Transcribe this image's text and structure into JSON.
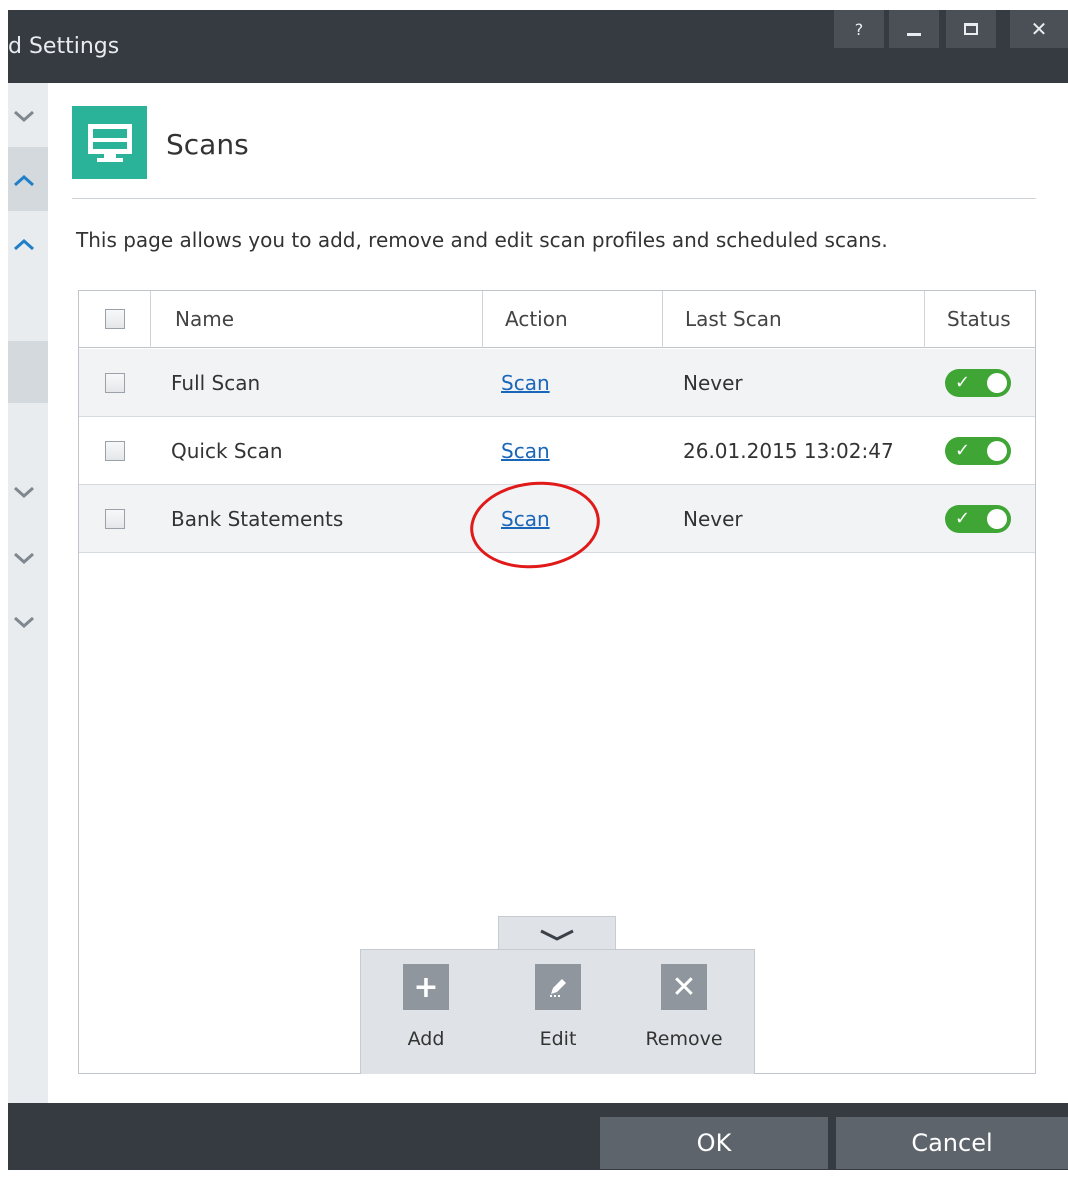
{
  "window": {
    "title": "d Settings",
    "controls": {
      "help": "?"
    }
  },
  "page": {
    "title": "Scans",
    "description": "This page allows you to add, remove and edit scan profiles and scheduled scans."
  },
  "table": {
    "columns": [
      "Name",
      "Action",
      "Last Scan",
      "Status"
    ],
    "rows": [
      {
        "name": "Full Scan",
        "action": "Scan",
        "last_scan": "Never",
        "status_on": true
      },
      {
        "name": "Quick Scan",
        "action": "Scan",
        "last_scan": "26.01.2015 13:02:47",
        "status_on": true
      },
      {
        "name": "Bank Statements",
        "action": "Scan",
        "last_scan": "Never",
        "status_on": true
      }
    ]
  },
  "actions": {
    "add": "Add",
    "edit": "Edit",
    "remove": "Remove"
  },
  "footer": {
    "ok": "OK",
    "cancel": "Cancel"
  },
  "colors": {
    "accent": "#2bb39a",
    "titlebar": "#353b41",
    "toggle_on": "#3fa535",
    "link": "#1a66b8",
    "highlight": "#e01919"
  }
}
